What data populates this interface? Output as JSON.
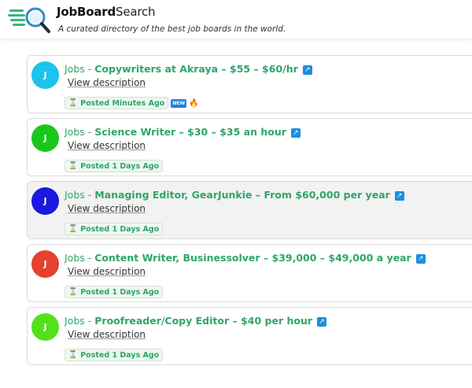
{
  "header": {
    "brand_bold": "JobBoard",
    "brand_light": "Search",
    "tagline": "A curated directory of the best job boards in the world."
  },
  "icons": {
    "logo": "magnifier-speed-lines-icon",
    "external": "external-link-icon",
    "hourglass": "hourglass-icon",
    "new": "new-tag-icon",
    "fire": "fire-icon"
  },
  "jobs": [
    {
      "avatar": "J",
      "avatar_color": "#1cc3ec",
      "prefix": "Jobs - ",
      "title": "Copywriters at Akraya – $55 – $60/hr",
      "desc": "View description",
      "posted": "Posted Minutes Ago",
      "is_new": true,
      "hot": true,
      "highlighted": false
    },
    {
      "avatar": "J",
      "avatar_color": "#17c81b",
      "prefix": "Jobs - ",
      "title": "Science Writer – $30 – $35 an hour",
      "desc": "View description",
      "posted": "Posted 1 Days Ago",
      "is_new": false,
      "hot": false,
      "highlighted": false
    },
    {
      "avatar": "J",
      "avatar_color": "#1b18e0",
      "prefix": "Jobs - ",
      "title": "Managing Editor, GearJunkie – From $60,000 per year",
      "desc": "View description",
      "posted": "Posted 1 Days Ago",
      "is_new": false,
      "hot": false,
      "highlighted": true
    },
    {
      "avatar": "J",
      "avatar_color": "#e4412f",
      "prefix": "Jobs - ",
      "title": "Content Writer, Businessolver – $39,000 – $49,000 a year",
      "desc": "View description",
      "posted": "Posted 1 Days Ago",
      "is_new": false,
      "hot": false,
      "highlighted": false
    },
    {
      "avatar": "J",
      "avatar_color": "#52e21a",
      "prefix": "Jobs - ",
      "title": "Proofreader/Copy Editor – $40 per hour",
      "desc": "View description",
      "posted": "Posted 1 Days Ago",
      "is_new": false,
      "hot": false,
      "highlighted": false
    }
  ],
  "colors": {
    "accent": "#2fa56a",
    "link": "#1a8fe0"
  }
}
